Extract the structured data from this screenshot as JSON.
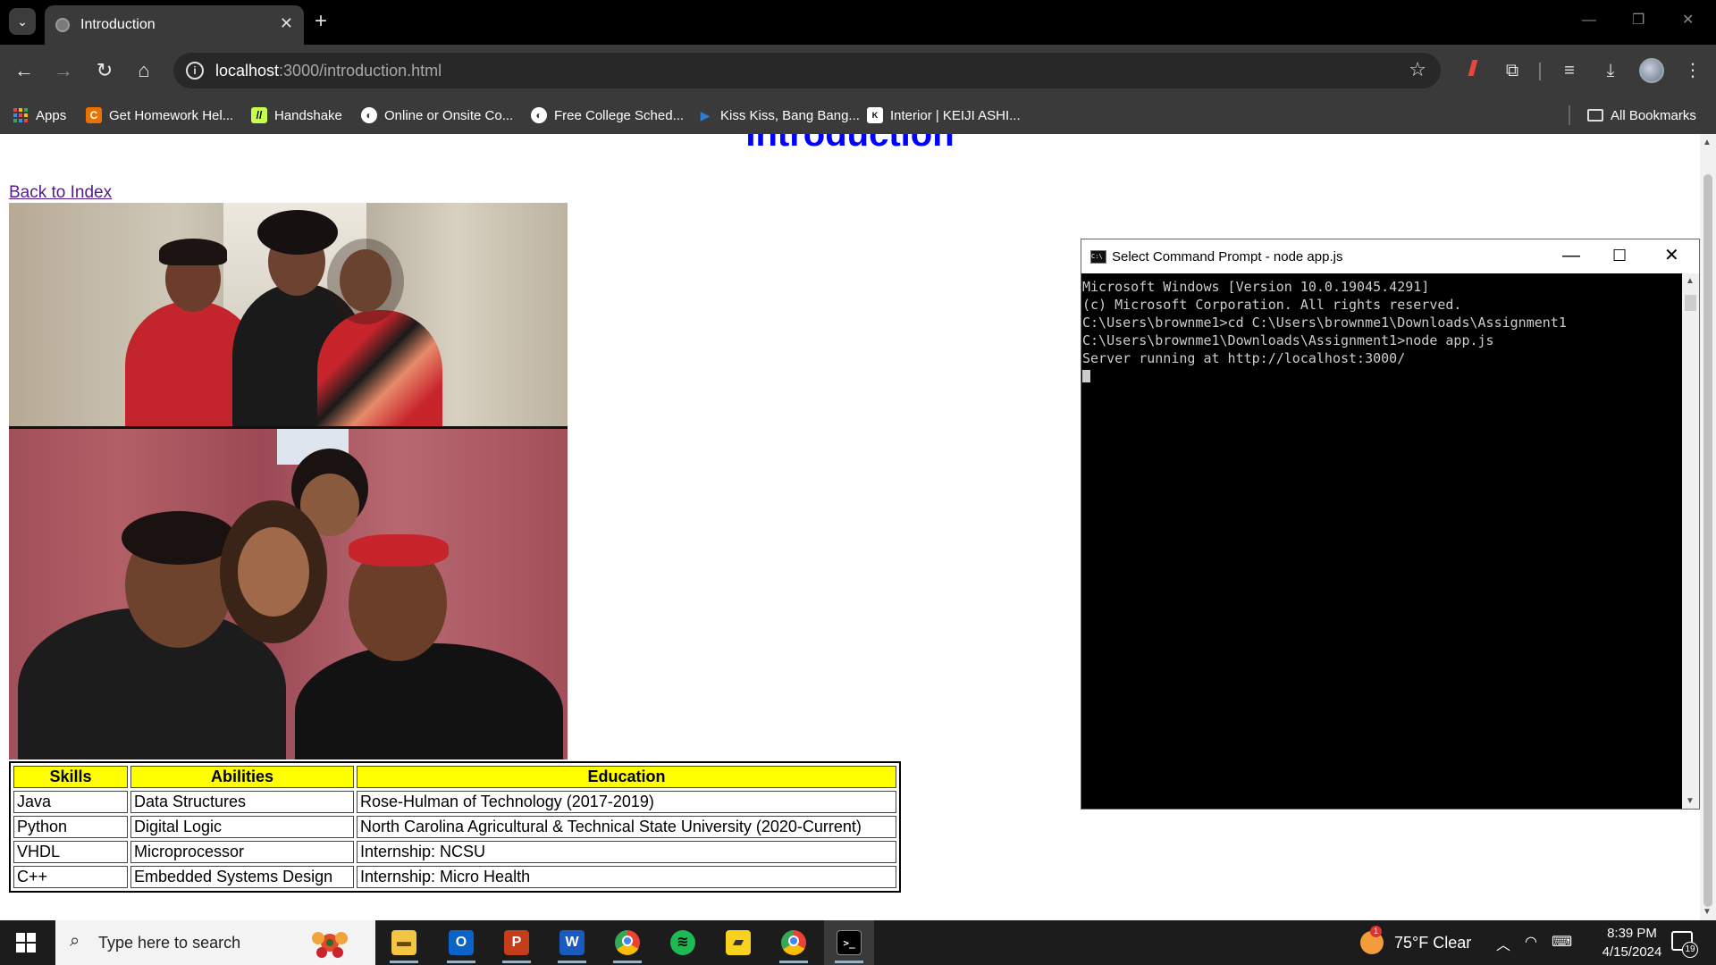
{
  "browser": {
    "tab_title": "Introduction",
    "url_host": "localhost",
    "url_path": ":3000/introduction.html",
    "bookmarks": [
      {
        "label": "Apps",
        "icon": "apps-grid-icon",
        "color": "#e8453c"
      },
      {
        "label": "Get Homework Hel...",
        "icon": "chegg-icon",
        "color": "#eb7100"
      },
      {
        "label": "Handshake",
        "icon": "handshake-icon",
        "color": "#c8ff4d"
      },
      {
        "label": "Online or Onsite Co...",
        "icon": "globe-icon",
        "color": "#ffffff"
      },
      {
        "label": "Free College Sched...",
        "icon": "globe-icon",
        "color": "#ffffff"
      },
      {
        "label": "Kiss Kiss, Bang Bang...",
        "icon": "play-icon",
        "color": "#2e7bd6"
      },
      {
        "label": "Interior | KEIJI ASHI...",
        "icon": "keiji-icon",
        "color": "#ffffff"
      }
    ],
    "all_bookmarks": "All Bookmarks"
  },
  "page": {
    "title": "Introduction",
    "back_link": "Back to Index",
    "table": {
      "headers": [
        "Skills",
        "Abilities",
        "Education"
      ],
      "header_color": "#ffff00",
      "rows": [
        [
          "Java",
          "Data Structures",
          "Rose-Hulman of Technology (2017-2019)"
        ],
        [
          "Python",
          "Digital Logic",
          "North Carolina Agricultural & Technical State University (2020-Current)"
        ],
        [
          "VHDL",
          "Microprocessor",
          "Internship: NCSU"
        ],
        [
          "C++",
          "Embedded Systems Design",
          "Internship: Micro Health"
        ]
      ]
    }
  },
  "cmd": {
    "title": "Select Command Prompt - node  app.js",
    "lines": [
      "Microsoft Windows [Version 10.0.19045.4291]",
      "(c) Microsoft Corporation. All rights reserved.",
      "",
      "C:\\Users\\brownme1>cd C:\\Users\\brownme1\\Downloads\\Assignment1",
      "",
      "C:\\Users\\brownme1\\Downloads\\Assignment1>node app.js",
      "Server running at http://localhost:3000/"
    ]
  },
  "taskbar": {
    "search_placeholder": "Type here to search",
    "apps": [
      {
        "name": "file-explorer",
        "color": "#f4c542",
        "glyph": "▬"
      },
      {
        "name": "outlook",
        "color": "#0a64c8",
        "glyph": "O"
      },
      {
        "name": "powerpoint",
        "color": "#c43e1c",
        "glyph": "P"
      },
      {
        "name": "word",
        "color": "#185abd",
        "glyph": "W"
      },
      {
        "name": "chrome",
        "color": "#4285f4",
        "glyph": "●"
      },
      {
        "name": "spotify",
        "color": "#1db954",
        "glyph": "≋"
      },
      {
        "name": "sticky-notes",
        "color": "#f8d21c",
        "glyph": "▰"
      },
      {
        "name": "chrome-profile",
        "color": "#34a853",
        "glyph": "●"
      },
      {
        "name": "command-prompt",
        "color": "#222222",
        "glyph": ">_"
      }
    ],
    "weather": "75°F  Clear",
    "weather_badge": "1",
    "time": "8:39 PM",
    "date": "4/15/2024",
    "notifications": "19"
  }
}
